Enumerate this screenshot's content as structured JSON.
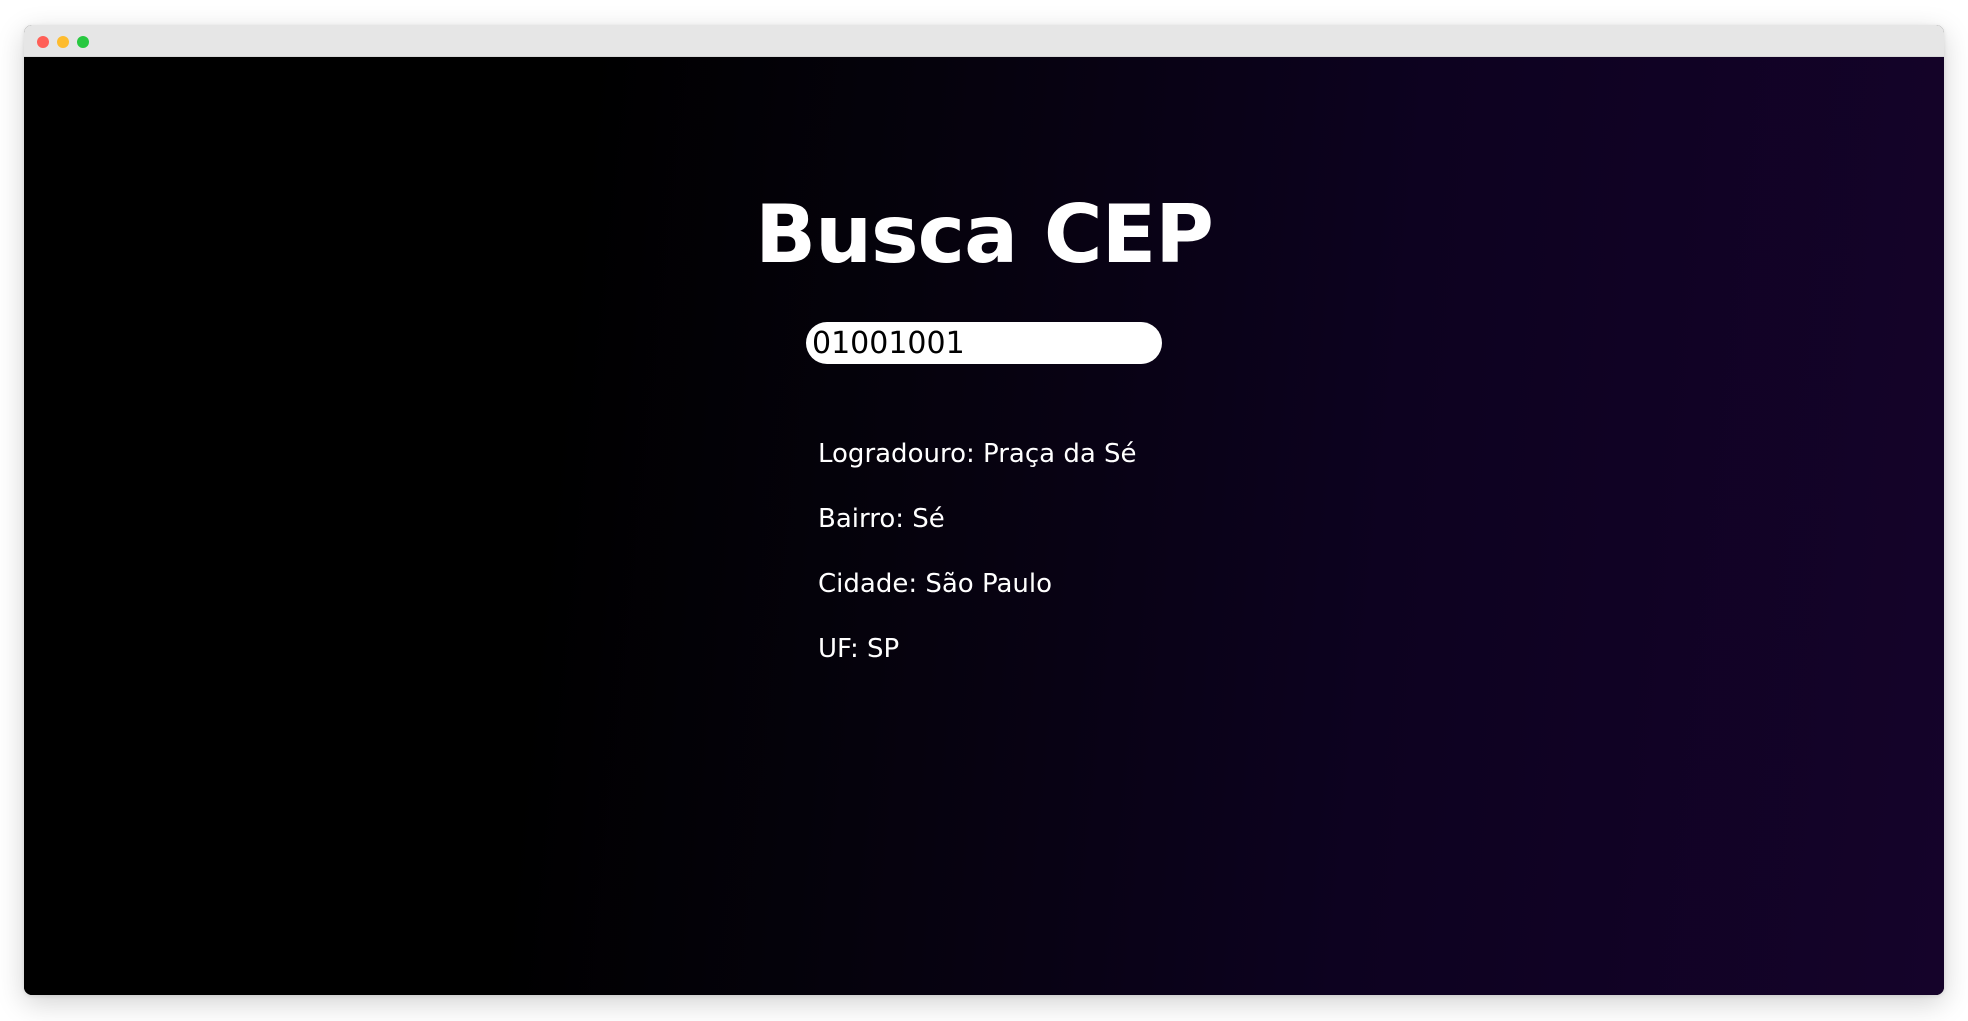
{
  "window": {
    "controls": {
      "close_color": "#ff5f57",
      "minimize_color": "#febc2e",
      "maximize_color": "#28c840"
    }
  },
  "app": {
    "title": "Busca CEP",
    "cep_input": {
      "value": "01001001",
      "placeholder": ""
    },
    "results": {
      "logradouro": "Logradouro: Praça da Sé",
      "bairro": "Bairro: Sé",
      "cidade": "Cidade: São Paulo",
      "uf": "UF: SP"
    }
  },
  "colors": {
    "background_start": "#000000",
    "background_end": "#15032a",
    "text": "#ffffff",
    "input_background": "#ffffff"
  }
}
